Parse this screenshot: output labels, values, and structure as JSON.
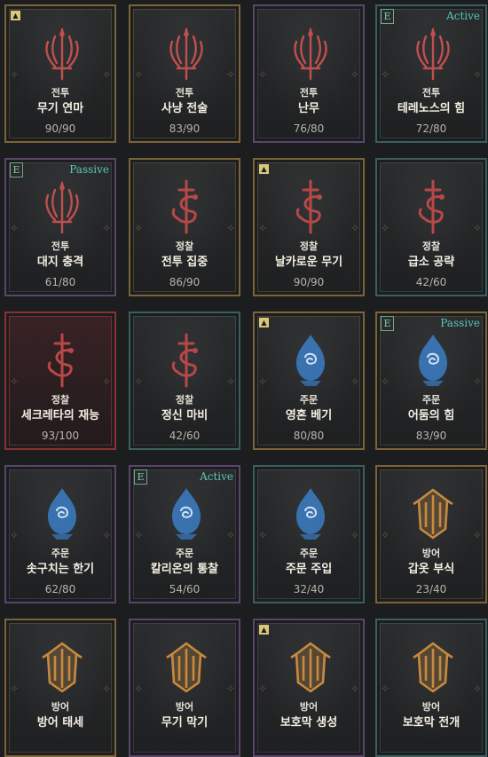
{
  "colors": {
    "combat": "#c0504e",
    "scheme": "#b84848",
    "spell": "#3b7ec4",
    "defense": "#c98a3e"
  },
  "skills": [
    {
      "category": "전투",
      "name": "무기 연마",
      "ranks": "90/90",
      "icon": "combat-icon",
      "frame": "gold",
      "marker": "upgrade-badge"
    },
    {
      "category": "전투",
      "name": "사냥 전술",
      "ranks": "83/90",
      "icon": "combat-icon",
      "frame": "gold"
    },
    {
      "category": "전투",
      "name": "난무",
      "ranks": "76/80",
      "icon": "combat-icon",
      "frame": "purple"
    },
    {
      "category": "전투",
      "name": "테레노스의 힘",
      "ranks": "72/80",
      "icon": "combat-icon",
      "frame": "teal",
      "marker": "E",
      "status": "Active"
    },
    {
      "category": "전투",
      "name": "대지 충격",
      "ranks": "61/80",
      "icon": "combat-icon",
      "frame": "purple",
      "marker": "E",
      "status": "Passive"
    },
    {
      "category": "정찰",
      "name": "전투 집중",
      "ranks": "86/90",
      "icon": "scheme-icon",
      "frame": "gold"
    },
    {
      "category": "정찰",
      "name": "날카로운 무기",
      "ranks": "90/90",
      "icon": "scheme-icon",
      "frame": "gold",
      "marker": "upgrade-badge"
    },
    {
      "category": "정찰",
      "name": "급소 공략",
      "ranks": "42/60",
      "icon": "scheme-icon",
      "frame": "teal"
    },
    {
      "category": "정찰",
      "name": "세크레타의 재능",
      "ranks": "93/100",
      "icon": "scheme-icon",
      "frame": "red"
    },
    {
      "category": "정찰",
      "name": "정신 마비",
      "ranks": "42/60",
      "icon": "scheme-icon",
      "frame": "teal"
    },
    {
      "category": "주문",
      "name": "영혼 베기",
      "ranks": "80/80",
      "icon": "spell-icon",
      "frame": "gold",
      "marker": "upgrade-badge"
    },
    {
      "category": "주문",
      "name": "어둠의 힘",
      "ranks": "83/90",
      "icon": "spell-icon",
      "frame": "gold",
      "marker": "E",
      "status": "Passive"
    },
    {
      "category": "주문",
      "name": "솟구치는 한기",
      "ranks": "62/80",
      "icon": "spell-icon",
      "frame": "purple"
    },
    {
      "category": "주문",
      "name": "칼리온의 통찰",
      "ranks": "54/60",
      "icon": "spell-icon",
      "frame": "purple",
      "marker": "E",
      "status": "Active"
    },
    {
      "category": "주문",
      "name": "주문 주입",
      "ranks": "32/40",
      "icon": "spell-icon",
      "frame": "teal"
    },
    {
      "category": "방어",
      "name": "갑옷 부식",
      "ranks": "23/40",
      "icon": "defense-icon",
      "frame": "gold"
    },
    {
      "category": "방어",
      "name": "방어 태세",
      "ranks": "",
      "icon": "defense-icon",
      "frame": "gold"
    },
    {
      "category": "방어",
      "name": "무기 막기",
      "ranks": "",
      "icon": "defense-icon",
      "frame": "purple"
    },
    {
      "category": "방어",
      "name": "보호막 생성",
      "ranks": "",
      "icon": "defense-icon",
      "frame": "purple",
      "marker": "upgrade-badge"
    },
    {
      "category": "방어",
      "name": "보호막 전개",
      "ranks": "",
      "icon": "defense-icon",
      "frame": "teal"
    }
  ]
}
